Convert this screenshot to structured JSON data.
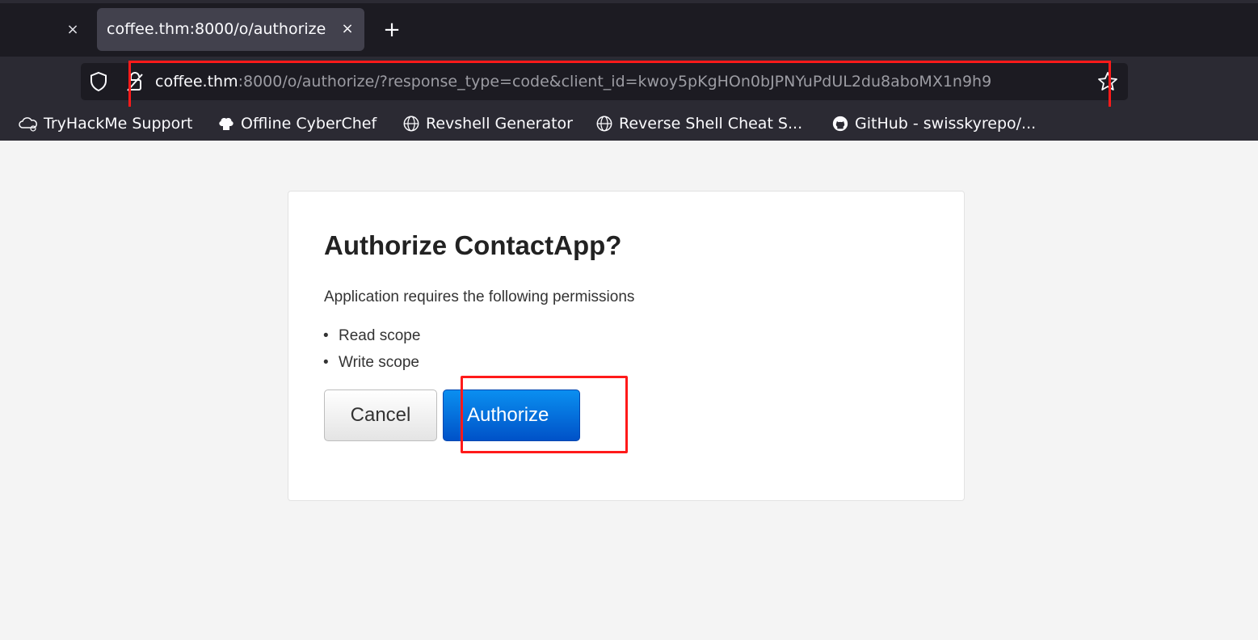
{
  "browser": {
    "tab_close_glyph": "×",
    "active_tab": {
      "title": "coffee.thm:8000/o/authorize",
      "close_glyph": "×"
    },
    "new_tab_glyph": "+",
    "url": {
      "host": "coffee.thm",
      "rest": ":8000/o/authorize/?response_type=code&client_id=kwoy5pKgHOn0bJPNYuPdUL2du8aboMX1n9h9"
    },
    "bookmarks": [
      {
        "label": "TryHackMe Support",
        "icon": "cloud-icon"
      },
      {
        "label": "Offline CyberChef",
        "icon": "chef-hat-icon"
      },
      {
        "label": "Revshell Generator",
        "icon": "globe-icon"
      },
      {
        "label": "Reverse Shell Cheat S...",
        "icon": "globe-icon"
      },
      {
        "label": "GitHub - swisskyrepo/...",
        "icon": "github-icon"
      }
    ]
  },
  "page": {
    "title": "Authorize ContactApp?",
    "description": "Application requires the following permissions",
    "permissions": [
      "Read scope",
      "Write scope"
    ],
    "cancel_label": "Cancel",
    "authorize_label": "Authorize"
  },
  "colors": {
    "annotation": "#ff1a1a",
    "authorize_button": "#0a6fe0"
  }
}
